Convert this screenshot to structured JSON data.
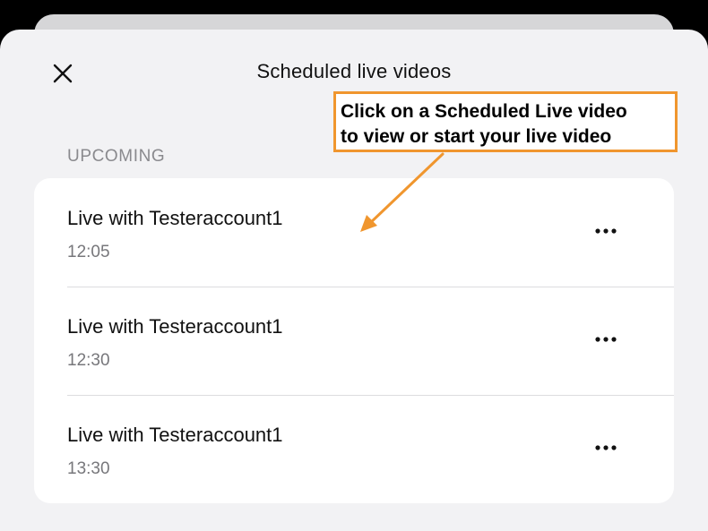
{
  "header": {
    "title": "Scheduled live videos",
    "close_icon": "close-icon"
  },
  "section": {
    "label": "UPCOMING"
  },
  "items": [
    {
      "title": "Live with Testeraccount1",
      "time": "12:05"
    },
    {
      "title": "Live with Testeraccount1",
      "time": "12:30"
    },
    {
      "title": "Live with Testeraccount1",
      "time": "13:30"
    }
  ],
  "annotation": {
    "line1": "Click on a Scheduled Live video",
    "line2": "to view or start your live video",
    "color": "#f0962e"
  }
}
